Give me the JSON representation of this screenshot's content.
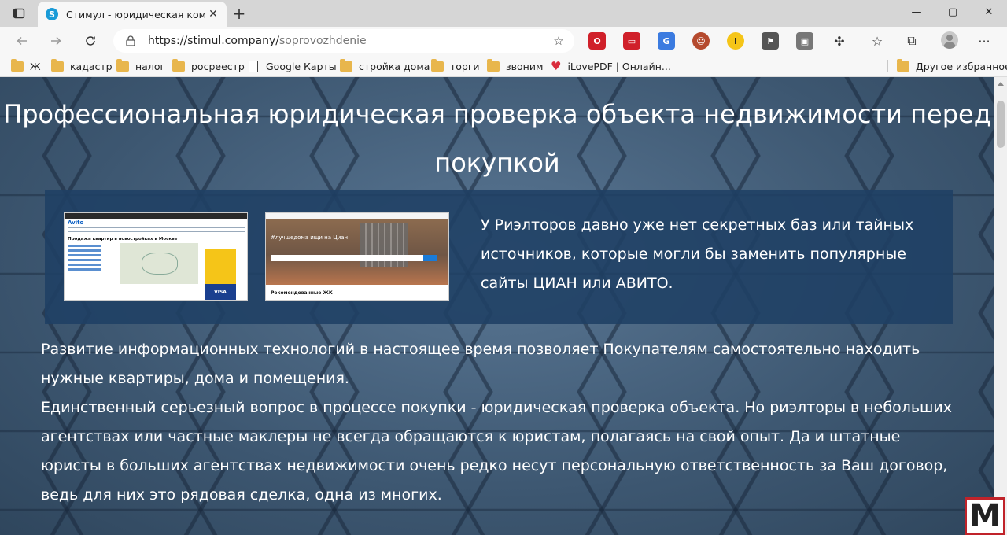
{
  "browser": {
    "tab": {
      "title": "Стимул - юридическая компания",
      "favicon_letter": "S"
    },
    "omnibox": {
      "url_host": "https://stimul.company/",
      "url_path": "soprovozhdenie"
    },
    "window_controls": {
      "minimize": "—",
      "maximize": "▢",
      "close": "✕"
    },
    "bookmarks": [
      {
        "label": "Ж",
        "icon": "folder-icon"
      },
      {
        "label": "кадастр",
        "icon": "folder-icon"
      },
      {
        "label": "налог",
        "icon": "folder-icon"
      },
      {
        "label": "росреестр",
        "icon": "folder-icon"
      },
      {
        "label": "Google Карты",
        "icon": "document-icon"
      },
      {
        "label": "стройка дома",
        "icon": "folder-icon"
      },
      {
        "label": "торги",
        "icon": "folder-icon"
      },
      {
        "label": "звоним",
        "icon": "folder-icon"
      },
      {
        "label": "iLovePDF | Онлайн...",
        "icon": "heart-icon"
      }
    ],
    "other_bookmarks": "Другое избранное",
    "extensions": [
      {
        "name": "opera-extension-icon",
        "color": "#d0202a"
      },
      {
        "name": "red-extension-icon",
        "color": "#d0202a"
      },
      {
        "name": "translate-extension-icon",
        "color": "#3b7be0"
      },
      {
        "name": "avatar-extension-icon",
        "color": "#b54a2e"
      },
      {
        "name": "yellow-i-extension-icon",
        "color": "#f5c518"
      },
      {
        "name": "flag-extension-icon",
        "color": "#555555"
      },
      {
        "name": "cube-extension-icon",
        "color": "#777777"
      }
    ]
  },
  "page": {
    "title": "Профессиональная юридическая проверка объекта недвижимости перед покупкой",
    "panel": {
      "text": "У Риэлторов давно уже нет секретных баз или тайных источников, которые могли бы заменить популярные сайты ЦИАН или АВИТО.",
      "screenshot1": {
        "logo": "Avito",
        "heading": "Продажа квартир в новостройках в Москве",
        "ad_text": "VISA",
        "ad_caption": "РЕСПУБЛИКА"
      },
      "screenshot2": {
        "hero_text": "#лучшедома ищи на Циан",
        "caption": "Рекомендованные ЖК"
      }
    },
    "body": [
      "Развитие информационных технологий в настоящее время позволяет Покупателям самостоятельно находить нужные квартиры, дома и помещения.",
      "Единственный серьезный вопрос в процессе покупки - юридическая проверка объекта. Но риэлторы в небольших агентствах или частные маклеры не всегда обращаются к юристам, полагаясь на свой опыт. Да и штатные юристы в больших агентствах недвижимости очень редко несут персональную ответственность за Ваш договор, ведь для них это рядовая сделка, одна из многих."
    ]
  },
  "watermark": {
    "letter": "M"
  }
}
